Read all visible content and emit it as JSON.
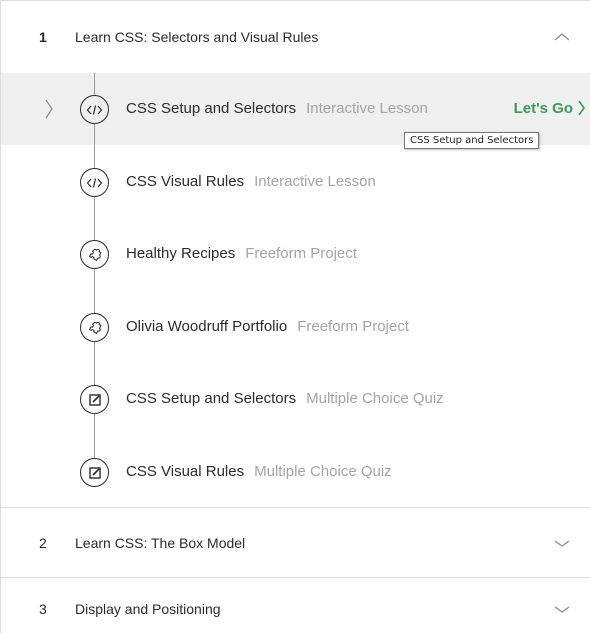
{
  "modules": [
    {
      "number": "1",
      "title": "Learn CSS: Selectors and Visual Rules",
      "expanded": true,
      "lessons": [
        {
          "title": "CSS Setup and Selectors",
          "type": "Interactive Lesson",
          "icon": "code-icon",
          "active": true,
          "action": "Let's Go"
        },
        {
          "title": "CSS Visual Rules",
          "type": "Interactive Lesson",
          "icon": "code-icon"
        },
        {
          "title": "Healthy Recipes",
          "type": "Freeform Project",
          "icon": "puzzle-icon"
        },
        {
          "title": "Olivia Woodruff Portfolio",
          "type": "Freeform Project",
          "icon": "puzzle-icon"
        },
        {
          "title": "CSS Setup and Selectors",
          "type": "Multiple Choice Quiz",
          "icon": "quiz-icon"
        },
        {
          "title": "CSS Visual Rules",
          "type": "Multiple Choice Quiz",
          "icon": "quiz-icon"
        }
      ]
    },
    {
      "number": "2",
      "title": "Learn CSS: The Box Model",
      "expanded": false
    },
    {
      "number": "3",
      "title": "Display and Positioning",
      "expanded": false
    }
  ],
  "tooltip": "CSS Setup and Selectors",
  "colors": {
    "accent": "#3a9b55",
    "muted": "#a4a4a4",
    "active_row": "#efefef",
    "border": "#dcdcdc"
  }
}
